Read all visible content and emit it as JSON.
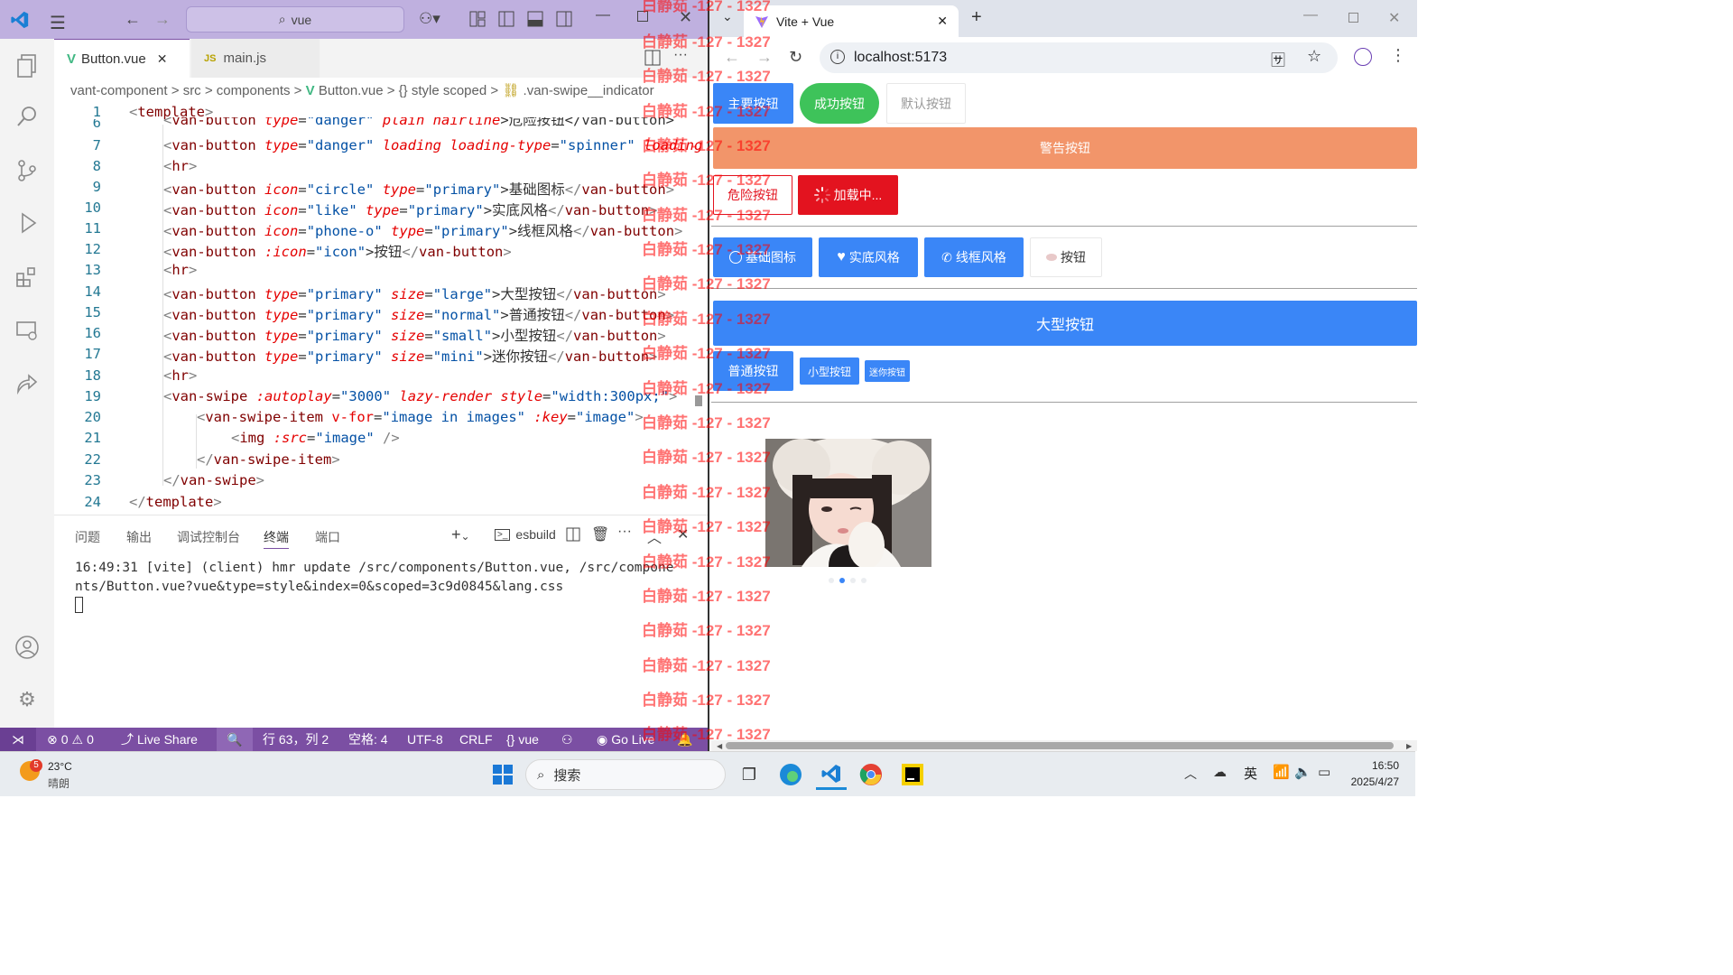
{
  "vscode": {
    "search_text": "vue",
    "tabs": [
      {
        "label": "Button.vue",
        "icon": "V"
      },
      {
        "label": "main.js",
        "icon": "JS"
      }
    ],
    "breadcrumb": [
      "vant-component",
      "src",
      "components",
      "Button.vue",
      "{} style scoped",
      ".van-swipe__indicator"
    ],
    "code_lines": [
      {
        "n": "1"
      },
      {
        "n": "6"
      },
      {
        "n": "7"
      },
      {
        "n": "8"
      },
      {
        "n": "9"
      },
      {
        "n": "10"
      },
      {
        "n": "11"
      },
      {
        "n": "12"
      },
      {
        "n": "13"
      },
      {
        "n": "14"
      },
      {
        "n": "15"
      },
      {
        "n": "16"
      },
      {
        "n": "17"
      },
      {
        "n": "18"
      },
      {
        "n": "19"
      },
      {
        "n": "20"
      },
      {
        "n": "21"
      },
      {
        "n": "22"
      },
      {
        "n": "23"
      },
      {
        "n": "24"
      }
    ],
    "panel_tabs": [
      "问题",
      "输出",
      "调试控制台",
      "终端",
      "端口"
    ],
    "terminal_name": "esbuild",
    "terminal_line1": "16:49:31 [vite] (client) hmr update /src/components/Button.vue, /src/compone",
    "terminal_line2": "nts/Button.vue?vue&type=style&index=0&scoped=3c9d0845&lang.css",
    "status": {
      "errors": "0",
      "warnings": "0",
      "live_share": "Live Share",
      "position": "行 63，列 2",
      "spaces": "空格: 4",
      "encoding": "UTF-8",
      "eol": "CRLF",
      "language": "vue",
      "go_live": "Go Live"
    }
  },
  "browser": {
    "tab_title": "Vite + Vue",
    "url": "localhost:5173",
    "buttons": {
      "primary": "主要按钮",
      "success": "成功按钮",
      "default": "默认按钮",
      "warning": "警告按钮",
      "danger": "危险按钮",
      "loading": "加载中...",
      "icon_basic": "基础图标",
      "icon_solid": "实底风格",
      "icon_outline": "线框风格",
      "icon_custom": "按钮",
      "large": "大型按钮",
      "normal": "普通按钮",
      "small": "小型按钮",
      "mini": "迷你按钮"
    },
    "swipe_indicator_active": 1,
    "swipe_indicator_count": 4,
    "colors": {
      "primary": "#3a86f7",
      "success": "#3ec35a",
      "warning": "#f2956a",
      "danger": "#e3131f"
    }
  },
  "watermark": "白静茹 -127 - 1327",
  "taskbar": {
    "temp": "23°C",
    "weather": "晴朗",
    "badge": "5",
    "search": "搜索",
    "ime": "英",
    "time": "16:50",
    "date": "2025/4/27"
  }
}
